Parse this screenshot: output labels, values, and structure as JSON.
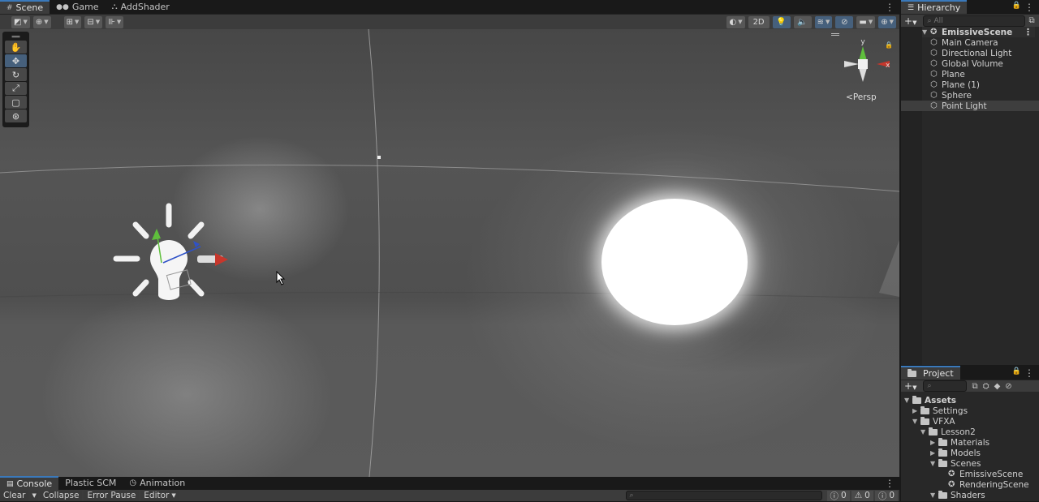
{
  "scene_tabs": {
    "scene": "Scene",
    "game": "Game",
    "addshader": "AddShader"
  },
  "scene_toolbar": {
    "mode_2d": "2D"
  },
  "gizmo": {
    "y_label": "y",
    "x_label": "x",
    "projection": "Persp"
  },
  "hierarchy": {
    "tab": "Hierarchy",
    "search_placeholder": "All",
    "scene_name": "EmissiveScene",
    "items": [
      {
        "label": "Main Camera"
      },
      {
        "label": "Directional Light"
      },
      {
        "label": "Global Volume"
      },
      {
        "label": "Plane"
      },
      {
        "label": "Plane (1)"
      },
      {
        "label": "Sphere"
      },
      {
        "label": "Point Light"
      }
    ]
  },
  "project": {
    "tab": "Project",
    "tree": [
      {
        "label": "Assets"
      },
      {
        "label": "Settings"
      },
      {
        "label": "VFXA"
      },
      {
        "label": "Lesson2"
      },
      {
        "label": "Materials"
      },
      {
        "label": "Models"
      },
      {
        "label": "Scenes"
      },
      {
        "label": "EmissiveScene"
      },
      {
        "label": "RenderingScene"
      },
      {
        "label": "Shaders"
      }
    ]
  },
  "console": {
    "tabs": [
      "Console",
      "Plastic SCM",
      "Animation"
    ],
    "clear": "Clear",
    "collapse": "Collapse",
    "error_pause": "Error Pause",
    "editor": "Editor",
    "count_errors": "0",
    "count_warnings": "0",
    "count_logs": "0"
  },
  "colors": {
    "accent": "#3a79bb",
    "selected_tool": "#46607c",
    "x_axis": "#c7372c",
    "y_axis": "#5fbf3c",
    "z_axis": "#2f52c8"
  }
}
